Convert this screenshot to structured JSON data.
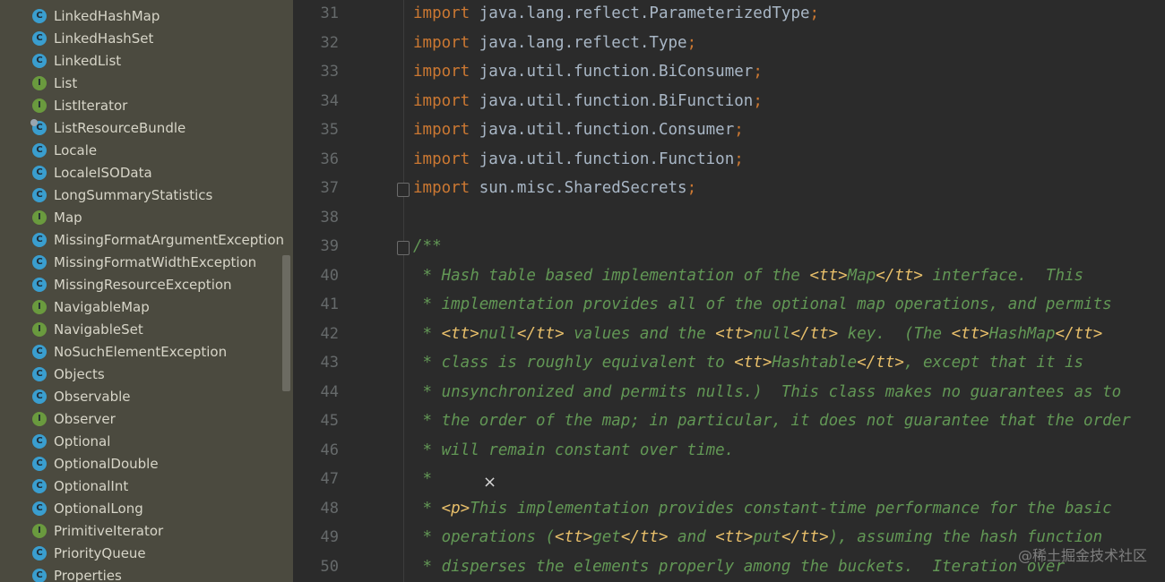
{
  "project_tree": {
    "items": [
      {
        "label": "LinkedHashMap",
        "kind": "class"
      },
      {
        "label": "LinkedHashSet",
        "kind": "class"
      },
      {
        "label": "LinkedList",
        "kind": "class"
      },
      {
        "label": "List",
        "kind": "interface"
      },
      {
        "label": "ListIterator",
        "kind": "interface"
      },
      {
        "label": "ListResourceBundle",
        "kind": "abstract-class"
      },
      {
        "label": "Locale",
        "kind": "class"
      },
      {
        "label": "LocaleISOData",
        "kind": "class"
      },
      {
        "label": "LongSummaryStatistics",
        "kind": "class"
      },
      {
        "label": "Map",
        "kind": "interface"
      },
      {
        "label": "MissingFormatArgumentException",
        "kind": "class"
      },
      {
        "label": "MissingFormatWidthException",
        "kind": "class"
      },
      {
        "label": "MissingResourceException",
        "kind": "class"
      },
      {
        "label": "NavigableMap",
        "kind": "interface"
      },
      {
        "label": "NavigableSet",
        "kind": "interface"
      },
      {
        "label": "NoSuchElementException",
        "kind": "class"
      },
      {
        "label": "Objects",
        "kind": "class"
      },
      {
        "label": "Observable",
        "kind": "class"
      },
      {
        "label": "Observer",
        "kind": "interface"
      },
      {
        "label": "Optional",
        "kind": "class"
      },
      {
        "label": "OptionalDouble",
        "kind": "class"
      },
      {
        "label": "OptionalInt",
        "kind": "class"
      },
      {
        "label": "OptionalLong",
        "kind": "class"
      },
      {
        "label": "PrimitiveIterator",
        "kind": "interface"
      },
      {
        "label": "PriorityQueue",
        "kind": "class"
      },
      {
        "label": "Properties",
        "kind": "class"
      }
    ],
    "icons": {
      "class": "C",
      "interface": "I"
    }
  },
  "editor": {
    "lines": [
      {
        "num": "31",
        "kind": "import",
        "keyword": "import",
        "path": "java.lang.reflect.ParameterizedType",
        "semi": ";"
      },
      {
        "num": "32",
        "kind": "import",
        "keyword": "import",
        "path": "java.lang.reflect.Type",
        "semi": ";"
      },
      {
        "num": "33",
        "kind": "import",
        "keyword": "import",
        "path": "java.util.function.BiConsumer",
        "semi": ";"
      },
      {
        "num": "34",
        "kind": "import",
        "keyword": "import",
        "path": "java.util.function.BiFunction",
        "semi": ";"
      },
      {
        "num": "35",
        "kind": "import",
        "keyword": "import",
        "path": "java.util.function.Consumer",
        "semi": ";"
      },
      {
        "num": "36",
        "kind": "import",
        "keyword": "import",
        "path": "java.util.function.Function",
        "semi": ";"
      },
      {
        "num": "37",
        "kind": "import",
        "keyword": "import",
        "path": "sun.misc.SharedSecrets",
        "semi": ";"
      },
      {
        "num": "38",
        "kind": "blank"
      },
      {
        "num": "39",
        "kind": "doc",
        "parts": [
          {
            "t": "doc",
            "s": "/**"
          }
        ]
      },
      {
        "num": "40",
        "kind": "doc",
        "parts": [
          {
            "t": "doc",
            "s": " * Hash table based implementation of the "
          },
          {
            "t": "tag",
            "s": "<tt>"
          },
          {
            "t": "doc",
            "s": "Map"
          },
          {
            "t": "tag",
            "s": "</tt>"
          },
          {
            "t": "doc",
            "s": " interface.  This"
          }
        ]
      },
      {
        "num": "41",
        "kind": "doc",
        "parts": [
          {
            "t": "doc",
            "s": " * implementation provides all of the optional map operations, and permits"
          }
        ]
      },
      {
        "num": "42",
        "kind": "doc",
        "parts": [
          {
            "t": "doc",
            "s": " * "
          },
          {
            "t": "tag",
            "s": "<tt>"
          },
          {
            "t": "doc",
            "s": "null"
          },
          {
            "t": "tag",
            "s": "</tt>"
          },
          {
            "t": "doc",
            "s": " values and the "
          },
          {
            "t": "tag",
            "s": "<tt>"
          },
          {
            "t": "doc",
            "s": "null"
          },
          {
            "t": "tag",
            "s": "</tt>"
          },
          {
            "t": "doc",
            "s": " key.  (The "
          },
          {
            "t": "tag",
            "s": "<tt>"
          },
          {
            "t": "doc",
            "s": "HashMap"
          },
          {
            "t": "tag",
            "s": "</tt>"
          }
        ]
      },
      {
        "num": "43",
        "kind": "doc",
        "parts": [
          {
            "t": "doc",
            "s": " * class is roughly equivalent to "
          },
          {
            "t": "tag",
            "s": "<tt>"
          },
          {
            "t": "doc",
            "s": "Hashtable"
          },
          {
            "t": "tag",
            "s": "</tt>"
          },
          {
            "t": "doc",
            "s": ", except that it is"
          }
        ]
      },
      {
        "num": "44",
        "kind": "doc",
        "parts": [
          {
            "t": "doc",
            "s": " * unsynchronized and permits nulls.)  This class makes no guarantees as to"
          }
        ]
      },
      {
        "num": "45",
        "kind": "doc",
        "parts": [
          {
            "t": "doc",
            "s": " * the order of the map; in particular, it does not guarantee that the order"
          }
        ]
      },
      {
        "num": "46",
        "kind": "doc",
        "parts": [
          {
            "t": "doc",
            "s": " * will remain constant over time."
          }
        ]
      },
      {
        "num": "47",
        "kind": "doc",
        "parts": [
          {
            "t": "doc",
            "s": " *"
          }
        ]
      },
      {
        "num": "48",
        "kind": "doc",
        "parts": [
          {
            "t": "doc",
            "s": " * "
          },
          {
            "t": "tag",
            "s": "<p>"
          },
          {
            "t": "doc",
            "s": "This implementation provides constant-time performance for the basic"
          }
        ]
      },
      {
        "num": "49",
        "kind": "doc",
        "parts": [
          {
            "t": "doc",
            "s": " * operations ("
          },
          {
            "t": "tag",
            "s": "<tt>"
          },
          {
            "t": "doc",
            "s": "get"
          },
          {
            "t": "tag",
            "s": "</tt>"
          },
          {
            "t": "doc",
            "s": " and "
          },
          {
            "t": "tag",
            "s": "<tt>"
          },
          {
            "t": "doc",
            "s": "put"
          },
          {
            "t": "tag",
            "s": "</tt>"
          },
          {
            "t": "doc",
            "s": "), assuming the hash function"
          }
        ]
      },
      {
        "num": "50",
        "kind": "doc",
        "parts": [
          {
            "t": "doc",
            "s": " * disperses the elements properly among the buckets.  Iteration over"
          }
        ]
      }
    ],
    "cursor_glyph": "×"
  },
  "colors": {
    "keyword": "#cc7832",
    "doc": "#629755",
    "doc_tag": "#e8bf6a",
    "identifier": "#a9b7c6",
    "panel_bg": "#4b4a3f",
    "editor_bg": "#2b2b2b"
  },
  "watermark": "@稀土掘金技术社区"
}
